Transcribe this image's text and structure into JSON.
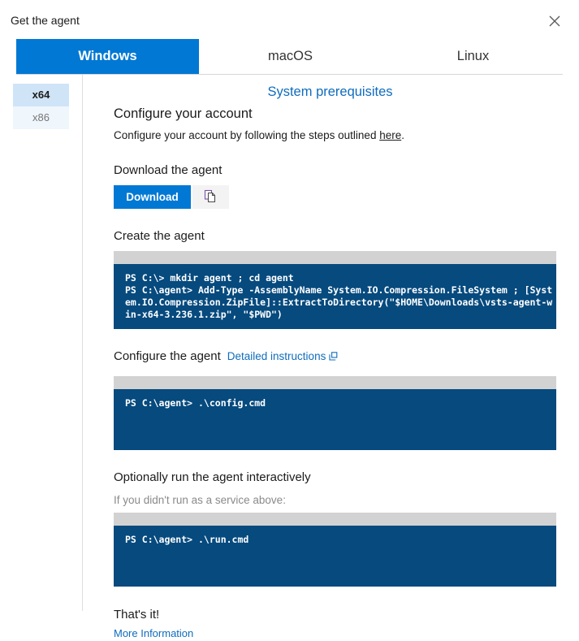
{
  "window": {
    "title": "Get the agent",
    "close_icon": "close-icon"
  },
  "tabs": [
    {
      "label": "Windows",
      "active": true
    },
    {
      "label": "macOS",
      "active": false
    },
    {
      "label": "Linux",
      "active": false
    }
  ],
  "sidebar": {
    "items": [
      {
        "label": "x64",
        "active": true
      },
      {
        "label": "x86",
        "active": false
      }
    ]
  },
  "main": {
    "prerequisites_link": "System prerequisites",
    "configure_account": {
      "heading": "Configure your account",
      "text_before": "Configure your account by following the steps outlined ",
      "link": "here",
      "text_after": "."
    },
    "download": {
      "heading": "Download the agent",
      "button_label": "Download",
      "copy_icon": "copy-icon"
    },
    "create": {
      "heading": "Create the agent",
      "code": "PS C:\\> mkdir agent ; cd agent\nPS C:\\agent> Add-Type -AssemblyName System.IO.Compression.FileSystem ; [System.IO.Compression.ZipFile]::ExtractToDirectory(\"$HOME\\Downloads\\vsts-agent-win-x64-3.236.1.zip\", \"$PWD\")"
    },
    "configure_agent": {
      "heading": "Configure the agent",
      "link": "Detailed instructions",
      "external_icon": "external-link-icon",
      "code": "PS C:\\agent> .\\config.cmd"
    },
    "run_interactively": {
      "heading": "Optionally run the agent interactively",
      "note": "If you didn't run as a service above:",
      "code": "PS C:\\agent> .\\run.cmd"
    },
    "footer": {
      "heading": "That's it!",
      "link": "More Information"
    }
  },
  "colors": {
    "accent": "#0078d4",
    "link": "#0f6cbd",
    "code_bg": "#064a7e",
    "code_head": "#d2d2d2",
    "sidebar_active": "#cfe4f7"
  }
}
